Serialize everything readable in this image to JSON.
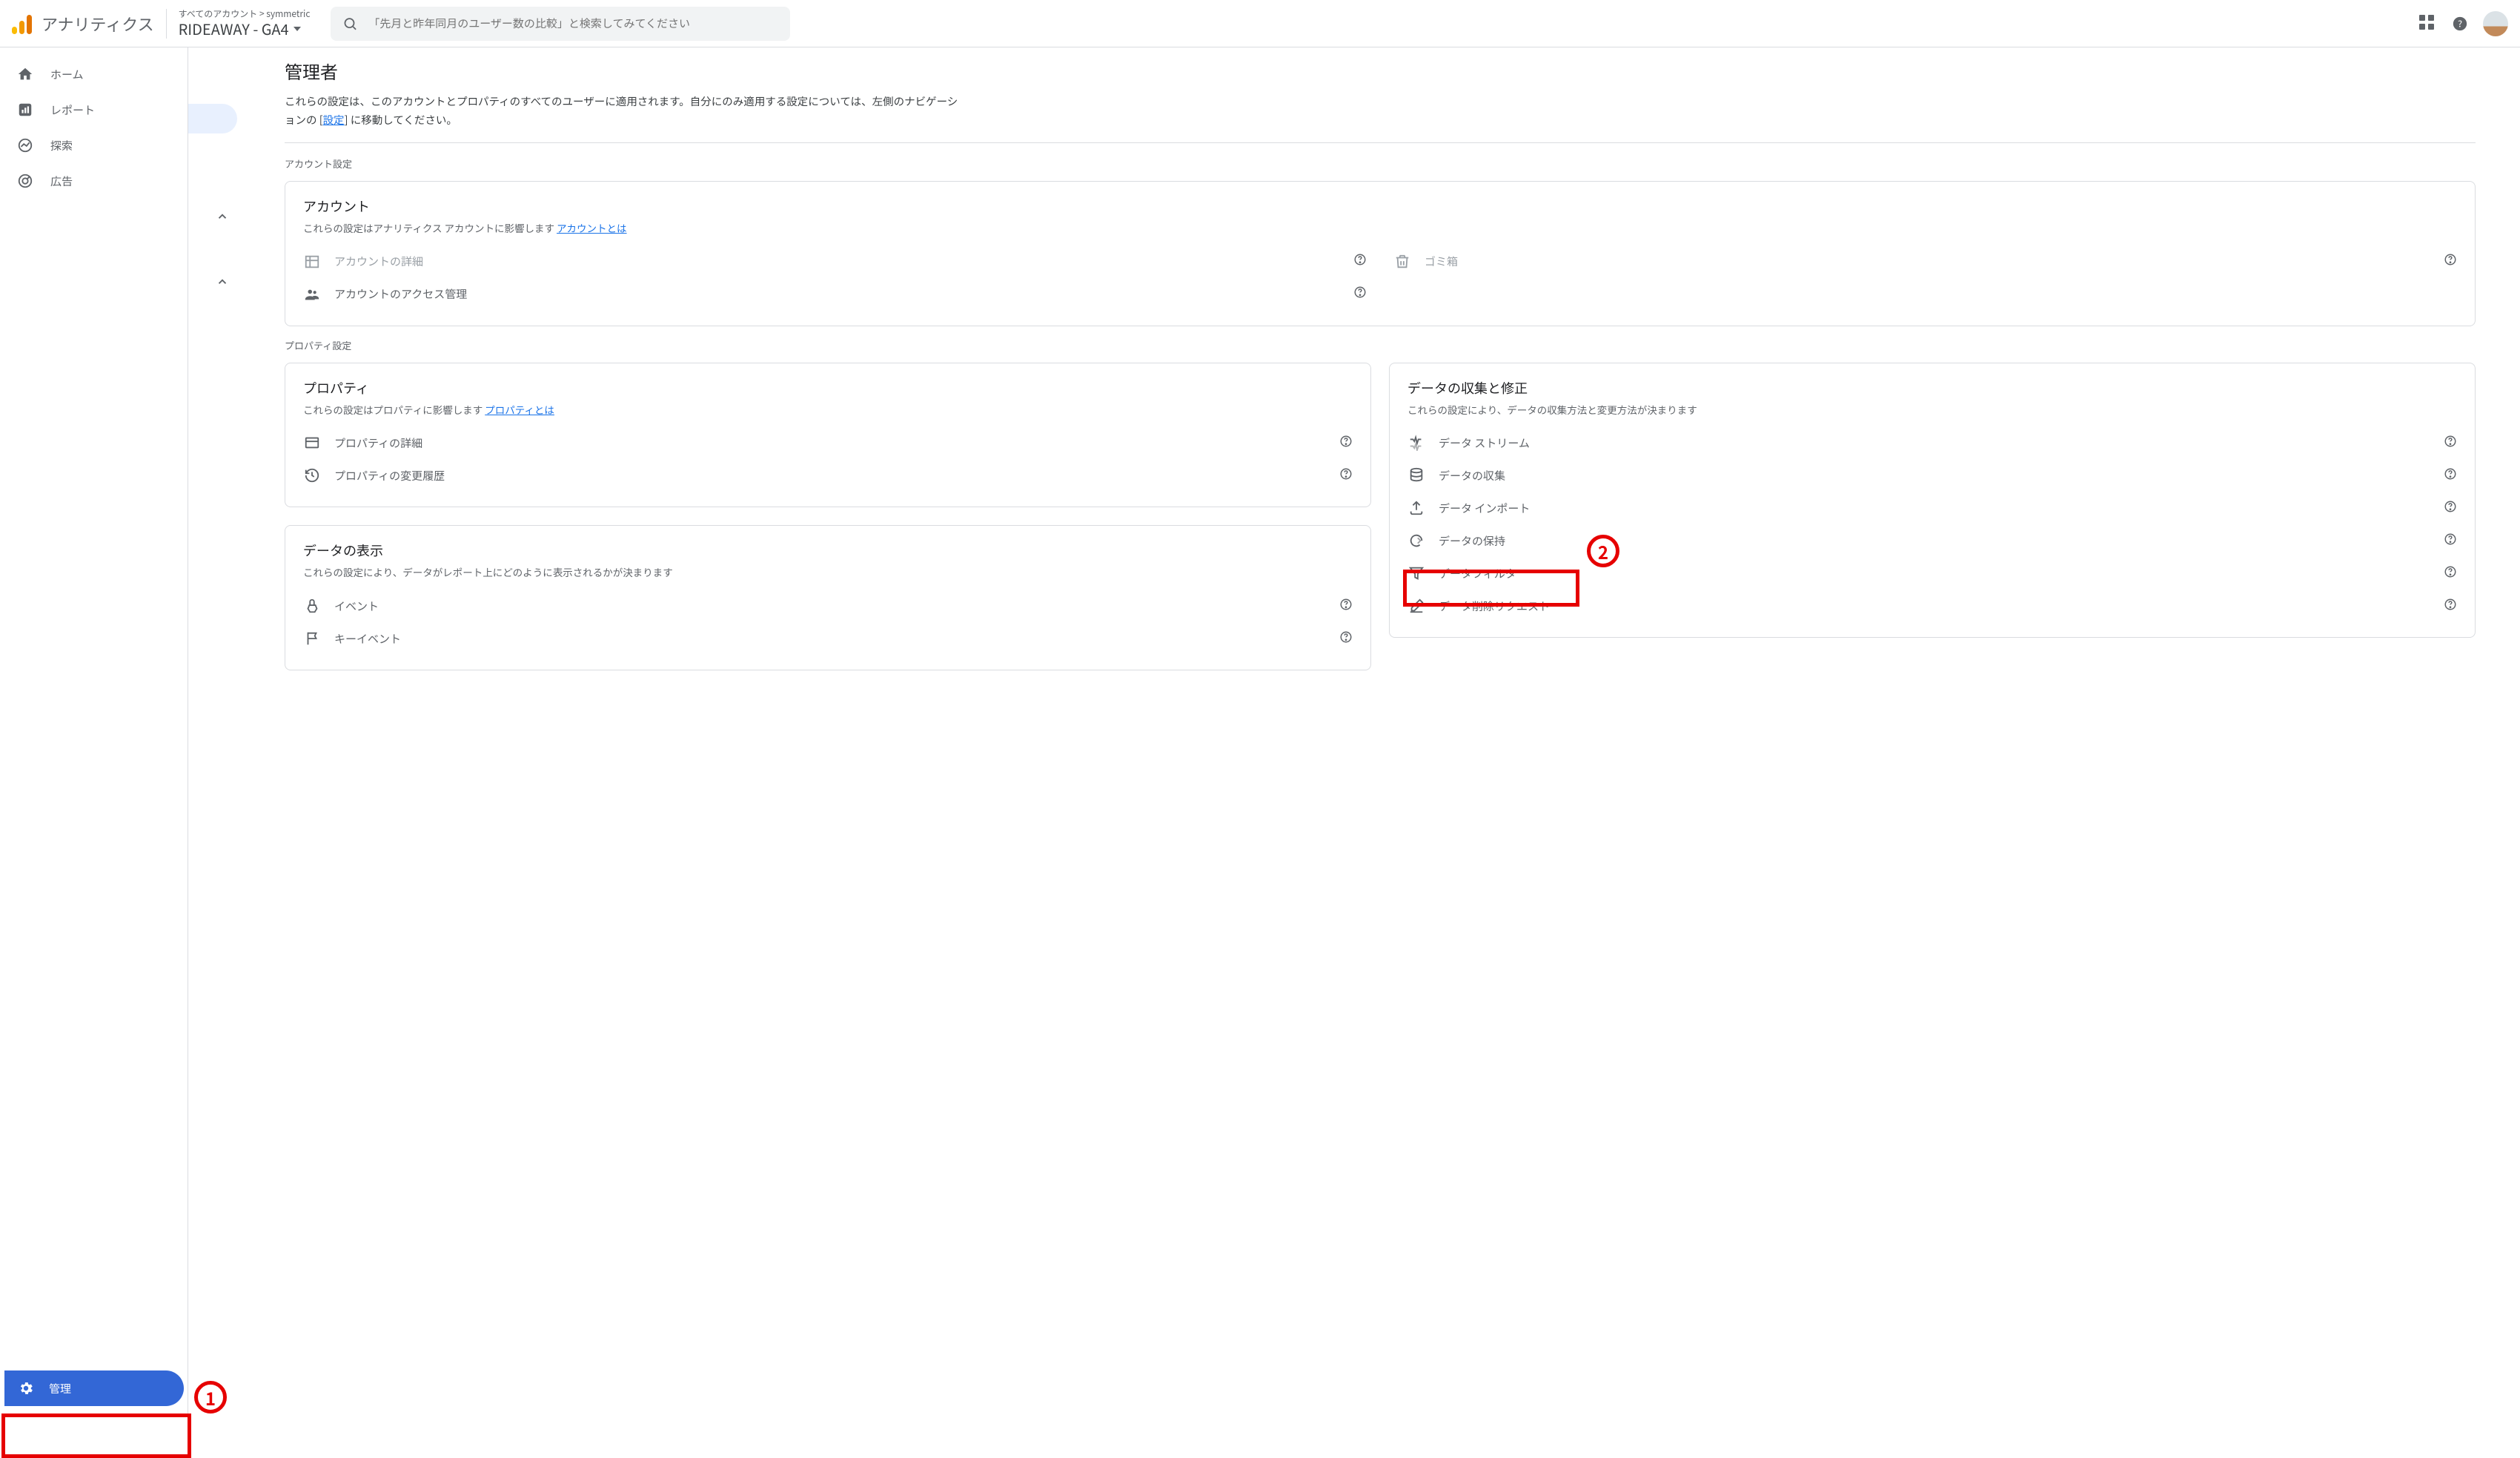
{
  "header": {
    "app_title": "アナリティクス",
    "breadcrumb": "すべてのアカウント > symmetric",
    "property": "RIDEAWAY - GA4",
    "search_placeholder": "「先月と昨年同月のユーザー数の比較」と検索してみてください"
  },
  "sidebar": {
    "items": [
      {
        "label": "ホーム"
      },
      {
        "label": "レポート"
      },
      {
        "label": "探索"
      },
      {
        "label": "広告"
      }
    ],
    "admin_label": "管理"
  },
  "page": {
    "title": "管理者",
    "desc_pre": "これらの設定は、このアカウントとプロパティのすべてのユーザーに適用されます。自分にのみ適用する設定については、左側のナビゲーションの [",
    "desc_link": "設定",
    "desc_post": "] に移動してください。"
  },
  "sections": {
    "account_label": "アカウント設定",
    "property_label": "プロパティ設定"
  },
  "cards": {
    "account": {
      "title": "アカウント",
      "desc_pre": "これらの設定はアナリティクス アカウントに影響します ",
      "desc_link": "アカウントとは",
      "entries_left": [
        {
          "label": "アカウントの詳細"
        },
        {
          "label": "アカウントのアクセス管理"
        }
      ],
      "entries_right": [
        {
          "label": "ゴミ箱"
        }
      ]
    },
    "property": {
      "title": "プロパティ",
      "desc_pre": "これらの設定はプロパティに影響します ",
      "desc_link": "プロパティとは",
      "entries": [
        {
          "label": "プロパティの詳細"
        },
        {
          "label": "プロパティの変更履歴"
        }
      ]
    },
    "display": {
      "title": "データの表示",
      "desc": "これらの設定により、データがレポート上にどのように表示されるかが決まります",
      "entries": [
        {
          "label": "イベント"
        },
        {
          "label": "キーイベント"
        }
      ]
    },
    "collect": {
      "title": "データの収集と修正",
      "desc": "これらの設定により、データの収集方法と変更方法が決まります",
      "entries": [
        {
          "label": "データ ストリーム"
        },
        {
          "label": "データの収集"
        },
        {
          "label": "データ インポート"
        },
        {
          "label": "データの保持"
        },
        {
          "label": "データフィルタ"
        },
        {
          "label": "データ削除リクエスト"
        }
      ]
    }
  },
  "annotations": {
    "one": "1",
    "two": "2"
  }
}
